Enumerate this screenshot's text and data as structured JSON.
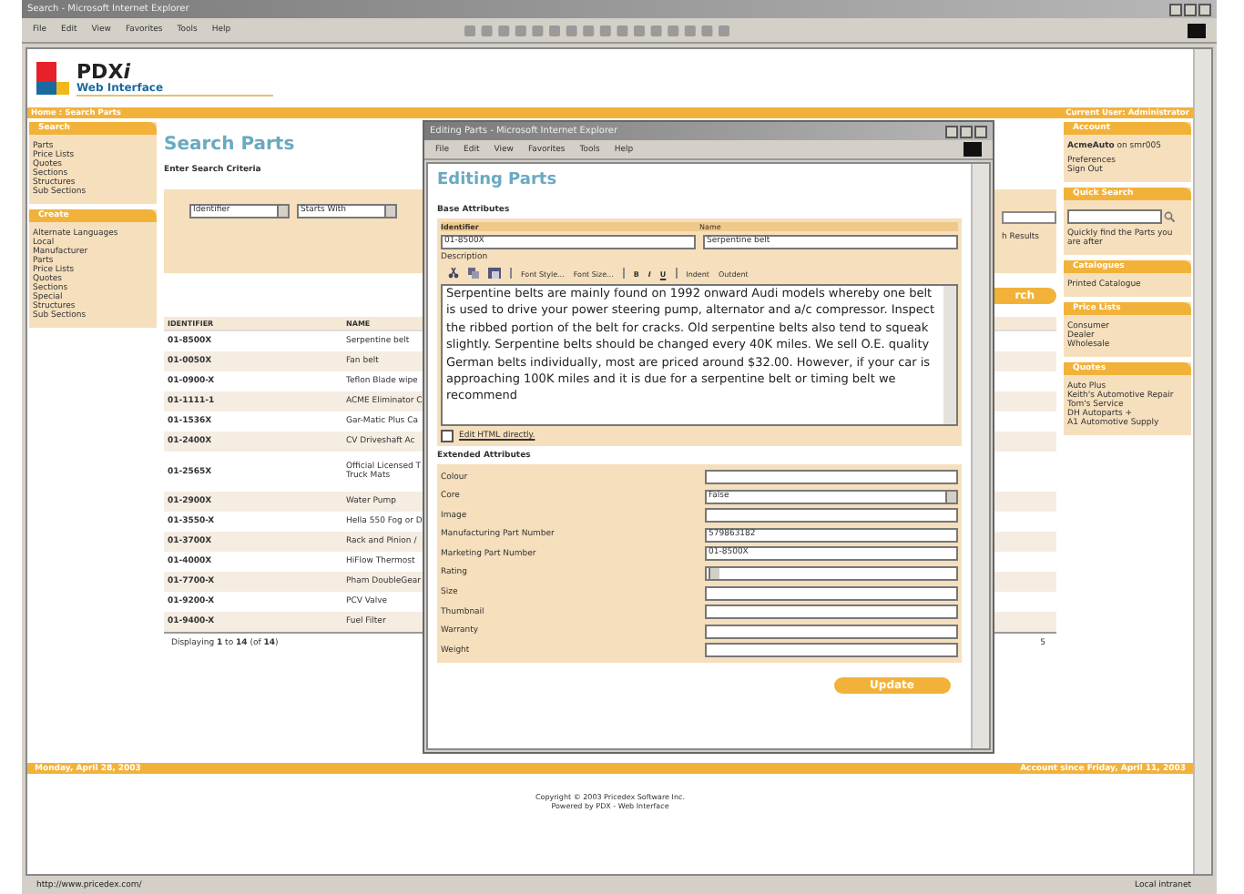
{
  "window": {
    "title": "Search - Microsoft Internet Explorer",
    "menu": [
      "File",
      "Edit",
      "View",
      "Favorites",
      "Tools",
      "Help"
    ]
  },
  "logo": {
    "name": "PDX",
    "suffix": "i",
    "subtitle": "Web Interface"
  },
  "nav": {
    "breadcrumb": "Home : Search Parts",
    "current_user": "Current User: Administrator"
  },
  "left_sidebar": [
    {
      "title": "Search",
      "items": [
        "Parts",
        "Price Lists",
        "Quotes",
        "Sections",
        "Structures",
        "Sub Sections"
      ]
    },
    {
      "title": "Create",
      "items": [
        "Alternate Languages",
        "Local",
        "Manufacturer",
        "Parts",
        "Price Lists",
        "Quotes",
        "Sections",
        "Special",
        "Structures",
        "Sub Sections"
      ]
    }
  ],
  "main": {
    "title": "Search Parts",
    "subtitle": "Enter Search Criteria",
    "field_select": "Identifier",
    "operator_select": "Starts With",
    "results_label": "h Results",
    "search_button": "rch",
    "columns": [
      "IDENTIFIER",
      "NAME"
    ],
    "rows": [
      {
        "id": "01-8500X",
        "name": "Serpentine belt"
      },
      {
        "id": "01-0050X",
        "name": "Fan belt"
      },
      {
        "id": "01-0900-X",
        "name": "Teflon Blade wipe"
      },
      {
        "id": "01-1111-1",
        "name": "ACME Eliminator C"
      },
      {
        "id": "01-1536X",
        "name": "Gar-Matic Plus Ca"
      },
      {
        "id": "01-2400X",
        "name": "CV Driveshaft Ac"
      },
      {
        "id": "01-2565X",
        "name": "Official Licensed T\nTruck Mats"
      },
      {
        "id": "01-2900X",
        "name": "Water Pump"
      },
      {
        "id": "01-3550-X",
        "name": "Hella 550 Fog or D"
      },
      {
        "id": "01-3700X",
        "name": "Rack and Pinion /"
      },
      {
        "id": "01-4000X",
        "name": "HiFlow Thermost"
      },
      {
        "id": "01-7700-X",
        "name": "Pham DoubleGear"
      },
      {
        "id": "01-9200-X",
        "name": "PCV Valve"
      },
      {
        "id": "01-9400-X",
        "name": "Fuel Filter"
      }
    ],
    "paging": "Displaying **1** to **14** (of **14**)",
    "paging_end": "5"
  },
  "right_sidebar": [
    {
      "title": "Account",
      "kind": "account",
      "lines": [
        "**AcmeAuto** on smr005",
        "Preferences",
        "Sign Out"
      ]
    },
    {
      "title": "Quick Search",
      "kind": "search",
      "lines": [
        "Quickly find the Parts you are after"
      ]
    },
    {
      "title": "Catalogues",
      "kind": "list",
      "lines": [
        "Printed Catalogue"
      ]
    },
    {
      "title": "Price Lists",
      "kind": "list",
      "lines": [
        "Consumer",
        "Dealer",
        "Wholesale"
      ]
    },
    {
      "title": "Quotes",
      "kind": "list",
      "lines": [
        "Auto Plus",
        "Keith's Automotive Repair",
        "Tom's Service",
        "DH Autoparts +",
        "A1 Automotive Supply"
      ]
    }
  ],
  "footer": {
    "date": "Monday, April 28, 2003",
    "since": "Account since Friday, April 11, 2003",
    "copyright": "Copyright © 2003 Pricedex Software Inc.",
    "powered": "Powered by PDX - Web Interface"
  },
  "status_bar": {
    "url": "http://www.pricedex.com/",
    "zone": "Local intranet"
  },
  "dialog": {
    "title": "Editing Parts - Microsoft Internet Explorer",
    "menu": [
      "File",
      "Edit",
      "View",
      "Favorites",
      "Tools",
      "Help"
    ],
    "heading": "Editing Parts",
    "base_title": "Base Attributes",
    "identifier_label": "Identifier",
    "identifier": "01-8500X",
    "name_label": "Name",
    "name": "Serpentine belt",
    "description_label": "Description",
    "toolbar": [
      "Font Style...",
      "Font Size..."
    ],
    "format": [
      "B",
      "I",
      "U"
    ],
    "indent": [
      "Indent",
      "Outdent"
    ],
    "description": "Serpentine belts are mainly found on 1992 onward Audi models whereby one belt is used to drive your power steering pump, alternator and a/c compressor. Inspect the ribbed portion of the belt for cracks. Old serpentine belts also tend to squeak slightly. Serpentine belts should be changed every 40K miles. We sell O.E. quality German belts individually, most are priced around $32.00. However, if your car is approaching 100K miles and it is due for a serpentine belt or timing belt we recommend",
    "edit_html": {
      "label": "Edit HTML directly.",
      "checked": false
    },
    "extended_title": "Extended Attributes",
    "attributes": [
      {
        "label": "Colour",
        "kind": "text"
      },
      {
        "label": "Core",
        "value": "False",
        "kind": "select"
      },
      {
        "label": "Image",
        "kind": "text"
      },
      {
        "label": "Manufacturing Part Number",
        "value": "579863182",
        "kind": "text"
      },
      {
        "label": "Marketing Part Number",
        "value": "01-8500X",
        "kind": "text"
      },
      {
        "label": "Rating",
        "kind": "select"
      },
      {
        "label": "Size",
        "kind": "text"
      },
      {
        "label": "Thumbnail",
        "kind": "text"
      },
      {
        "label": "Warranty",
        "kind": "text"
      },
      {
        "label": "Weight",
        "kind": "text"
      }
    ],
    "update_button": "Update"
  }
}
